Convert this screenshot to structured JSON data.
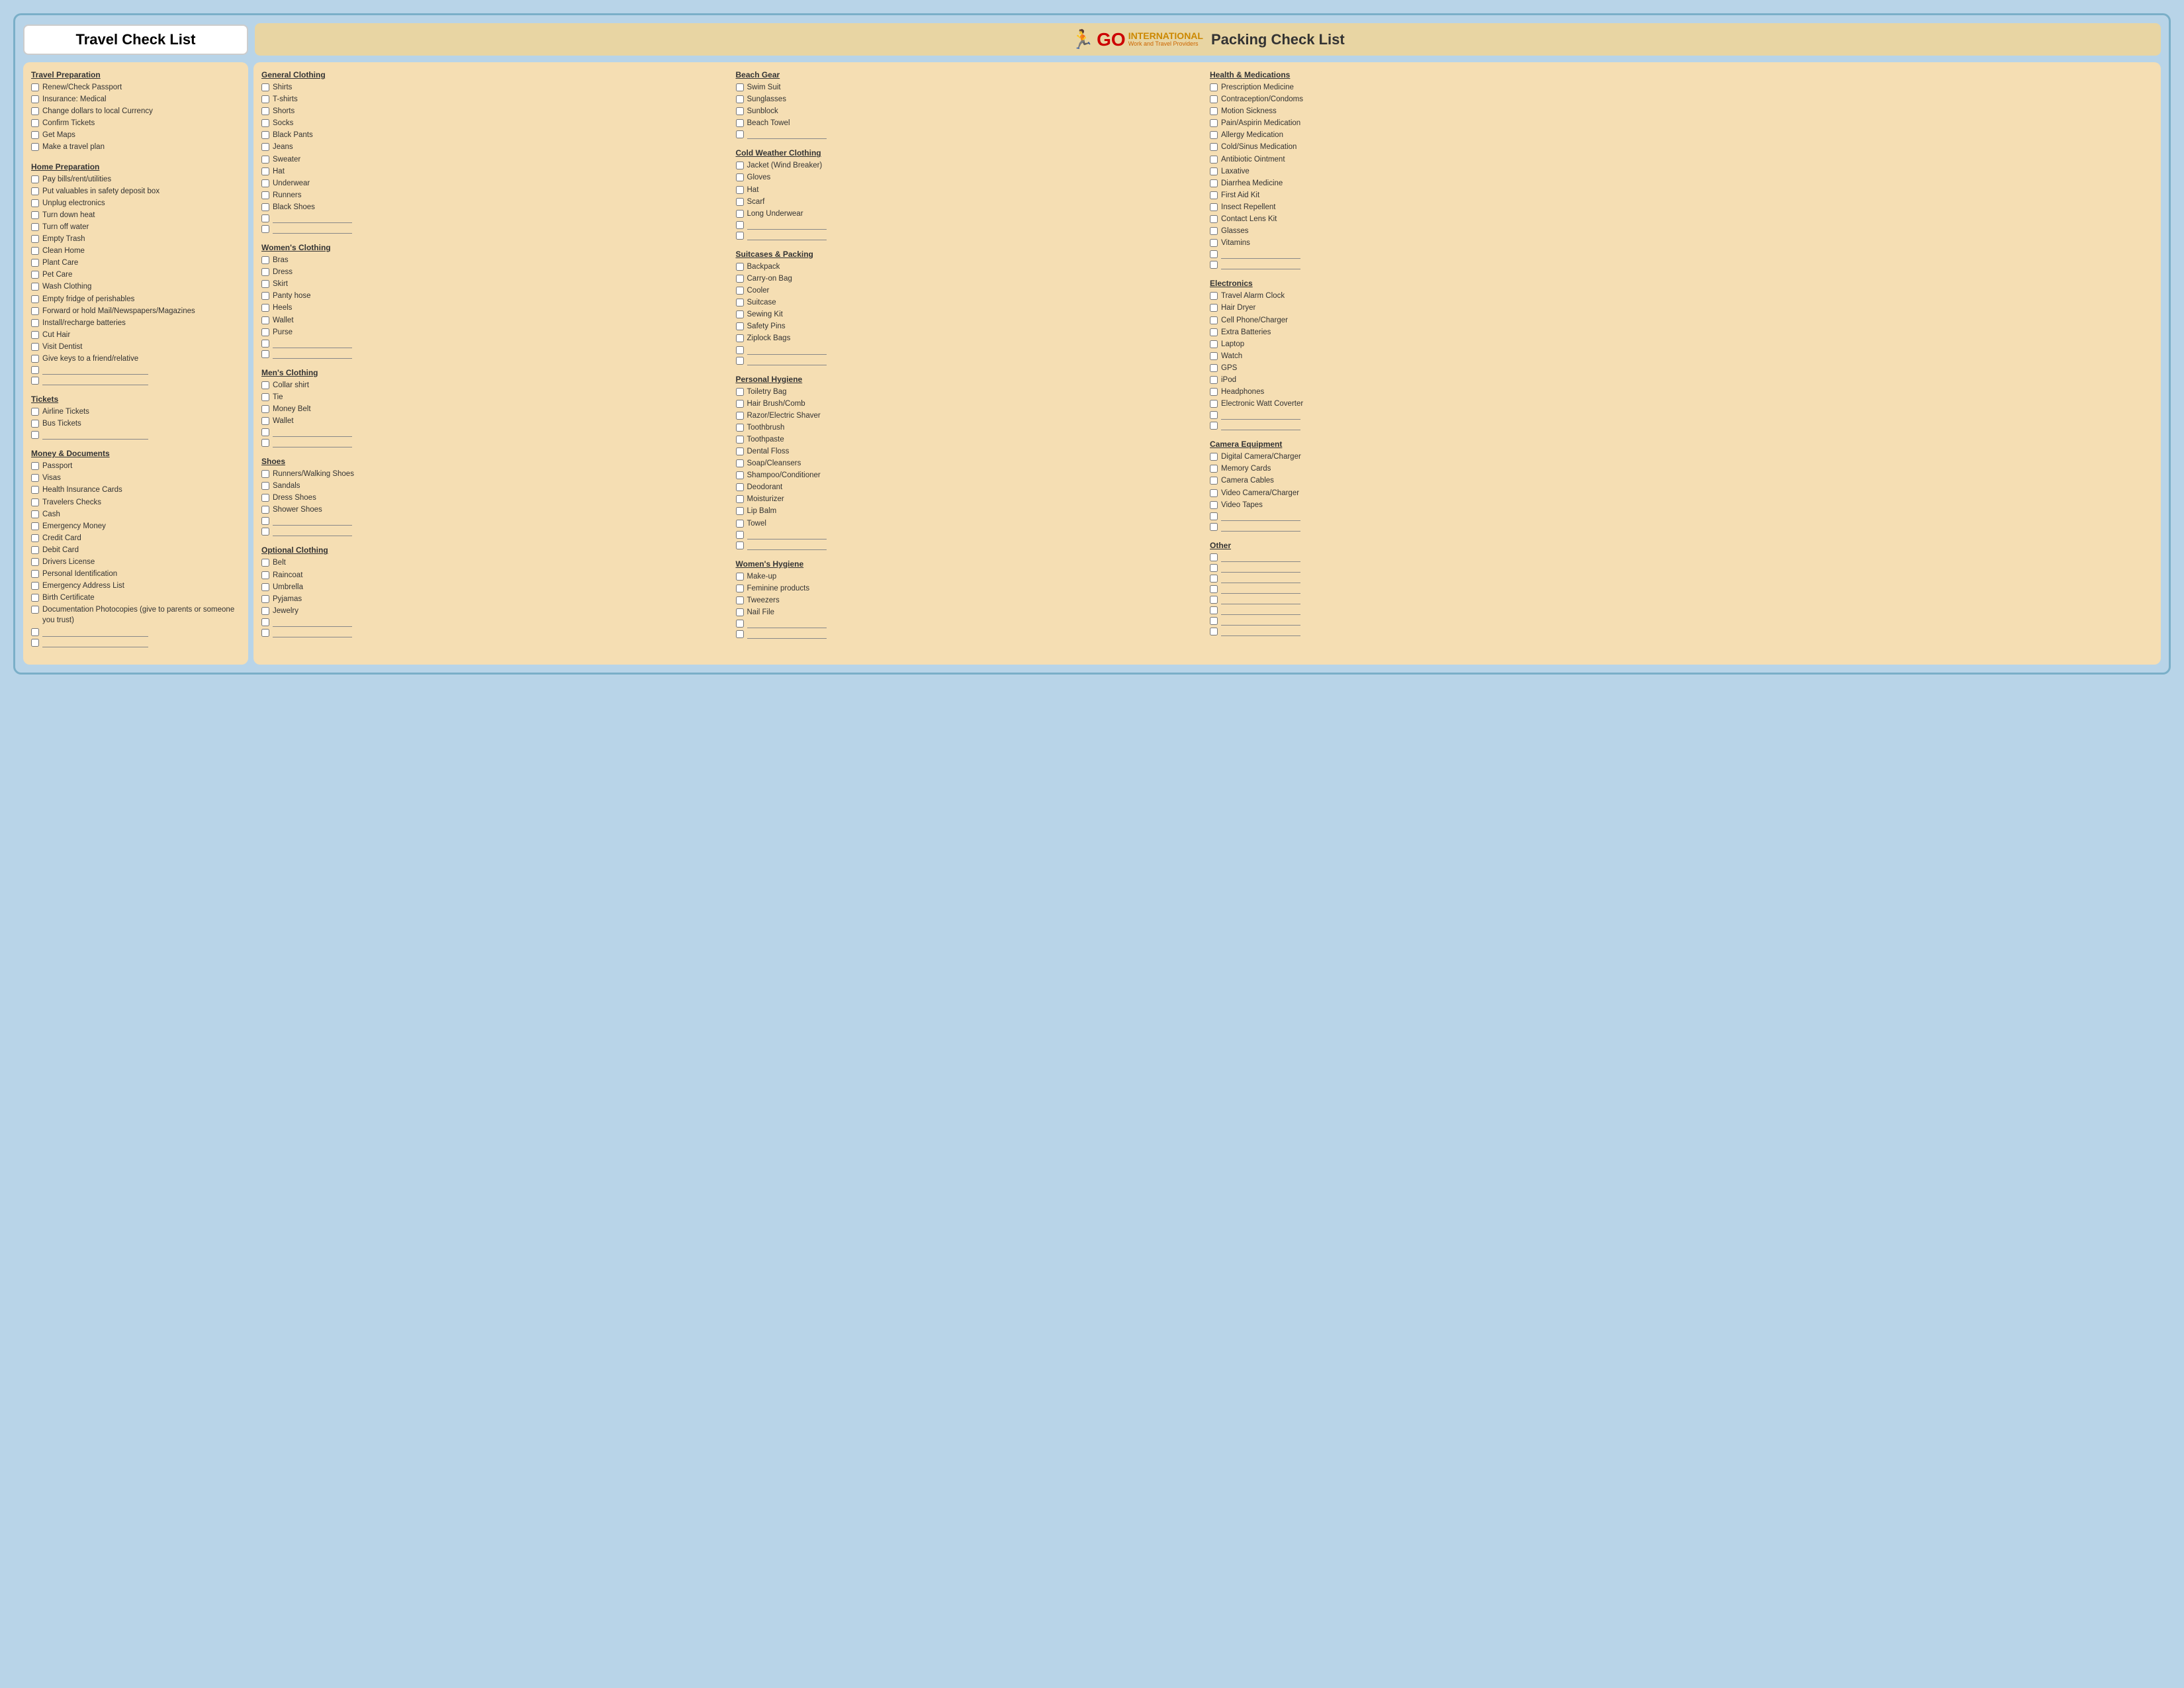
{
  "header": {
    "travel_title": "Travel Check List",
    "packing_title": "Packing Check List",
    "logo_icon": "🏃",
    "logo_go": "GO",
    "logo_international": "INTERNATIONAL",
    "logo_sub": "Work and Travel Providers"
  },
  "travel_sections": [
    {
      "id": "travel-preparation",
      "title": "Travel Preparation",
      "items": [
        "Renew/Check Passport",
        "Insurance: Medical",
        "Change dollars to local Currency",
        "Confirm Tickets",
        "Get Maps",
        "Make a travel plan"
      ],
      "blanks": 0
    },
    {
      "id": "home-preparation",
      "title": "Home Preparation",
      "items": [
        "Pay bills/rent/utilities",
        "Put valuables in safety deposit box",
        "Unplug electronics",
        "Turn down heat",
        "Turn off water",
        "Empty Trash",
        "Clean Home",
        "Plant Care",
        "Pet Care",
        "Wash Clothing",
        "Empty fridge of perishables",
        "Forward or hold Mail/Newspapers/Magazines",
        "Install/recharge batteries",
        "Cut Hair",
        "Visit Dentist",
        "Give keys to a friend/relative"
      ],
      "blanks": 2
    },
    {
      "id": "tickets",
      "title": "Tickets",
      "items": [
        "Airline Tickets",
        "Bus Tickets"
      ],
      "blanks": 1
    },
    {
      "id": "money-documents",
      "title": "Money & Documents",
      "items": [
        "Passport",
        "Visas",
        "Health Insurance Cards",
        "Travelers Checks",
        "Cash",
        "Emergency Money",
        "Credit Card",
        "Debit Card",
        "Drivers License",
        "Personal Identification",
        "Emergency Address List",
        "Birth Certificate",
        "Documentation Photocopies (give to parents or someone you trust)"
      ],
      "blanks": 2
    }
  ],
  "packing_col1": [
    {
      "id": "general-clothing",
      "title": "General Clothing",
      "items": [
        "Shirts",
        "T-shirts",
        "Shorts",
        "Socks",
        "Black Pants",
        "Jeans",
        "Sweater",
        "Hat",
        "Underwear",
        "Runners",
        "Black Shoes"
      ],
      "blanks": 2
    },
    {
      "id": "womens-clothing",
      "title": "Women's Clothing",
      "items": [
        "Bras",
        "Dress",
        "Skirt",
        "Panty hose",
        "Heels",
        "Wallet",
        "Purse"
      ],
      "blanks": 2
    },
    {
      "id": "mens-clothing",
      "title": "Men's Clothing",
      "items": [
        "Collar shirt",
        "Tie",
        "Money Belt",
        "Wallet"
      ],
      "blanks": 2
    },
    {
      "id": "shoes",
      "title": "Shoes",
      "items": [
        "Runners/Walking Shoes",
        "Sandals",
        "Dress Shoes",
        "Shower Shoes"
      ],
      "blanks": 2
    },
    {
      "id": "optional-clothing",
      "title": "Optional Clothing",
      "items": [
        "Belt",
        "Raincoat",
        "Umbrella",
        "Pyjamas",
        "Jewelry"
      ],
      "blanks": 2
    }
  ],
  "packing_col2": [
    {
      "id": "beach-gear",
      "title": "Beach Gear",
      "items": [
        "Swim Suit",
        "Sunglasses",
        "Sunblock",
        "Beach Towel"
      ],
      "blanks": 1
    },
    {
      "id": "cold-weather-clothing",
      "title": "Cold Weather Clothing",
      "items": [
        "Jacket (Wind Breaker)",
        "Gloves",
        "Hat",
        "Scarf",
        "Long Underwear"
      ],
      "blanks": 2
    },
    {
      "id": "suitcases-packing",
      "title": "Suitcases & Packing",
      "items": [
        "Backpack",
        "Carry-on Bag",
        "Cooler",
        "Suitcase",
        "Sewing Kit",
        "Safety Pins",
        "Ziplock Bags"
      ],
      "blanks": 2
    },
    {
      "id": "personal-hygiene",
      "title": "Personal Hygiene",
      "items": [
        "Toiletry Bag",
        "Hair Brush/Comb",
        "Razor/Electric Shaver",
        "Toothbrush",
        "Toothpaste",
        "Dental Floss",
        "Soap/Cleansers",
        "Shampoo/Conditioner",
        "Deodorant",
        "Moisturizer",
        "Lip Balm",
        "Towel"
      ],
      "blanks": 2
    },
    {
      "id": "womens-hygiene",
      "title": "Women's Hygiene",
      "items": [
        "Make-up",
        "Feminine products",
        "Tweezers",
        "Nail File"
      ],
      "blanks": 2
    }
  ],
  "packing_col3": [
    {
      "id": "health-medications",
      "title": "Health & Medications",
      "items": [
        "Prescription Medicine",
        "Contraception/Condoms",
        "Motion Sickness",
        "Pain/Aspirin Medication",
        "Allergy Medication",
        "Cold/Sinus Medication",
        "Antibiotic Ointment",
        "Laxative",
        "Diarrhea Medicine",
        "First Aid Kit",
        "Insect Repellent",
        "Contact Lens Kit",
        "Glasses",
        "Vitamins"
      ],
      "blanks": 2
    },
    {
      "id": "electronics",
      "title": "Electronics",
      "items": [
        "Travel Alarm Clock",
        "Hair Dryer",
        "Cell Phone/Charger",
        "Extra Batteries",
        "Laptop",
        "Watch",
        "GPS",
        "iPod",
        "Headphones",
        "Electronic Watt Coverter"
      ],
      "blanks": 2
    },
    {
      "id": "camera-equipment",
      "title": "Camera Equipment",
      "items": [
        "Digital Camera/Charger",
        "Memory Cards",
        "Camera Cables",
        "Video Camera/Charger",
        "Video Tapes"
      ],
      "blanks": 2
    },
    {
      "id": "other",
      "title": "Other",
      "items": [],
      "blanks": 8
    }
  ]
}
